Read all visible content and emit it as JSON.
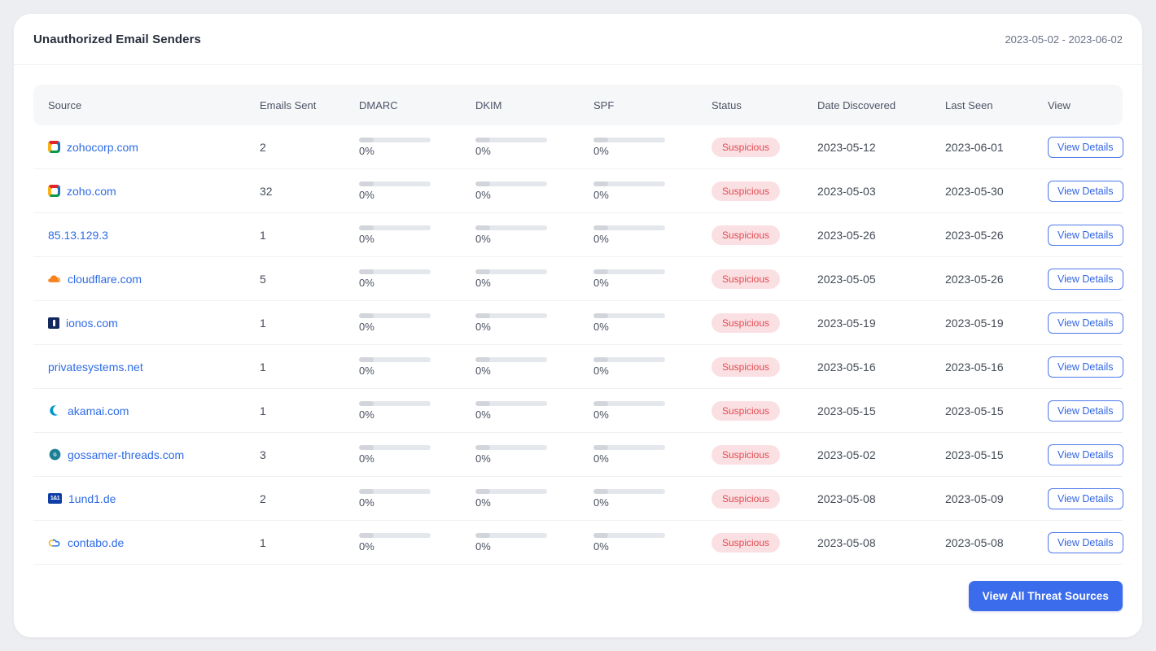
{
  "header": {
    "title": "Unauthorized Email Senders",
    "date_range": "2023-05-02 - 2023-06-02"
  },
  "table": {
    "columns": [
      "Source",
      "Emails Sent",
      "DMARC",
      "DKIM",
      "SPF",
      "Status",
      "Date Discovered",
      "Last Seen",
      "View"
    ],
    "view_button_label": "View Details",
    "rows": [
      {
        "icon": "zoho",
        "source": "zohocorp.com",
        "emails_sent": "2",
        "dmarc": "0%",
        "dkim": "0%",
        "spf": "0%",
        "status": "Suspicious",
        "date_discovered": "2023-05-12",
        "last_seen": "2023-06-01"
      },
      {
        "icon": "zoho",
        "source": "zoho.com",
        "emails_sent": "32",
        "dmarc": "0%",
        "dkim": "0%",
        "spf": "0%",
        "status": "Suspicious",
        "date_discovered": "2023-05-03",
        "last_seen": "2023-05-30"
      },
      {
        "icon": null,
        "source": "85.13.129.3",
        "emails_sent": "1",
        "dmarc": "0%",
        "dkim": "0%",
        "spf": "0%",
        "status": "Suspicious",
        "date_discovered": "2023-05-26",
        "last_seen": "2023-05-26"
      },
      {
        "icon": "cloudflare",
        "source": "cloudflare.com",
        "emails_sent": "5",
        "dmarc": "0%",
        "dkim": "0%",
        "spf": "0%",
        "status": "Suspicious",
        "date_discovered": "2023-05-05",
        "last_seen": "2023-05-26"
      },
      {
        "icon": "ionos",
        "source": "ionos.com",
        "emails_sent": "1",
        "dmarc": "0%",
        "dkim": "0%",
        "spf": "0%",
        "status": "Suspicious",
        "date_discovered": "2023-05-19",
        "last_seen": "2023-05-19"
      },
      {
        "icon": null,
        "source": "privatesystems.net",
        "emails_sent": "1",
        "dmarc": "0%",
        "dkim": "0%",
        "spf": "0%",
        "status": "Suspicious",
        "date_discovered": "2023-05-16",
        "last_seen": "2023-05-16"
      },
      {
        "icon": "akamai",
        "source": "akamai.com",
        "emails_sent": "1",
        "dmarc": "0%",
        "dkim": "0%",
        "spf": "0%",
        "status": "Suspicious",
        "date_discovered": "2023-05-15",
        "last_seen": "2023-05-15"
      },
      {
        "icon": "gossamer",
        "source": "gossamer-threads.com",
        "emails_sent": "3",
        "dmarc": "0%",
        "dkim": "0%",
        "spf": "0%",
        "status": "Suspicious",
        "date_discovered": "2023-05-02",
        "last_seen": "2023-05-15"
      },
      {
        "icon": "1und1",
        "source": "1und1.de",
        "emails_sent": "2",
        "dmarc": "0%",
        "dkim": "0%",
        "spf": "0%",
        "status": "Suspicious",
        "date_discovered": "2023-05-08",
        "last_seen": "2023-05-09"
      },
      {
        "icon": "contabo",
        "source": "contabo.de",
        "emails_sent": "1",
        "dmarc": "0%",
        "dkim": "0%",
        "spf": "0%",
        "status": "Suspicious",
        "date_discovered": "2023-05-08",
        "last_seen": "2023-05-08"
      }
    ]
  },
  "footer": {
    "view_all_label": "View All Threat Sources"
  },
  "colors": {
    "accent_blue": "#3b6ceb",
    "link_blue": "#2e6be6",
    "status_badge_bg": "#fbe0e3",
    "status_badge_text": "#e14a51",
    "header_row_bg": "#f6f7f9"
  }
}
